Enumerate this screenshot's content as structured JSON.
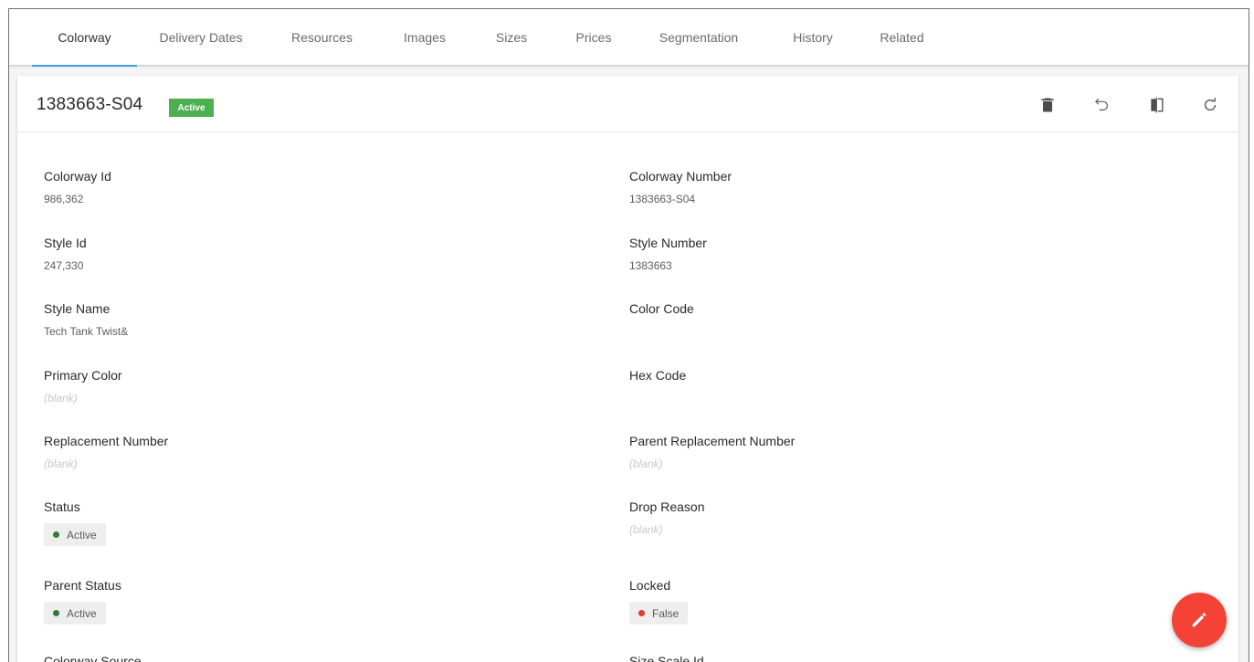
{
  "tabs": [
    {
      "label": "Colorway",
      "active": true
    },
    {
      "label": "Delivery Dates"
    },
    {
      "label": "Resources"
    },
    {
      "label": "Images"
    },
    {
      "label": "Sizes"
    },
    {
      "label": "Prices"
    },
    {
      "label": "Segmentation"
    },
    {
      "label": "History"
    },
    {
      "label": "Related"
    }
  ],
  "header": {
    "title": "1383663-S04",
    "badge": "Active",
    "badge_color": "#4caf50",
    "actions": [
      "delete-icon",
      "undo-icon",
      "compare-icon",
      "refresh-icon"
    ]
  },
  "fields": {
    "colorway_id": {
      "label": "Colorway Id",
      "value": "986,362"
    },
    "colorway_number": {
      "label": "Colorway Number",
      "value": "1383663-S04"
    },
    "style_id": {
      "label": "Style Id",
      "value": "247,330"
    },
    "style_number": {
      "label": "Style Number",
      "value": "1383663"
    },
    "style_name": {
      "label": "Style Name",
      "value": "Tech Tank Twist&"
    },
    "color_code": {
      "label": "Color Code",
      "value": ""
    },
    "primary_color": {
      "label": "Primary Color",
      "value": "(blank)"
    },
    "hex_code": {
      "label": "Hex Code",
      "value": ""
    },
    "replacement_number": {
      "label": "Replacement Number",
      "value": "(blank)"
    },
    "parent_replacement_number": {
      "label": "Parent Replacement Number",
      "value": "(blank)"
    },
    "status": {
      "label": "Status",
      "value": "Active",
      "dot_color": "#2e7d32"
    },
    "drop_reason": {
      "label": "Drop Reason",
      "value": "(blank)"
    },
    "parent_status": {
      "label": "Parent Status",
      "value": "Active",
      "dot_color": "#2e7d32"
    },
    "locked": {
      "label": "Locked",
      "value": "False",
      "dot_color": "#e53935"
    },
    "colorway_source": {
      "label": "Colorway Source"
    },
    "size_scale_id": {
      "label": "Size Scale Id"
    }
  },
  "fab": {
    "icon": "pencil-icon",
    "color": "#f44336"
  }
}
